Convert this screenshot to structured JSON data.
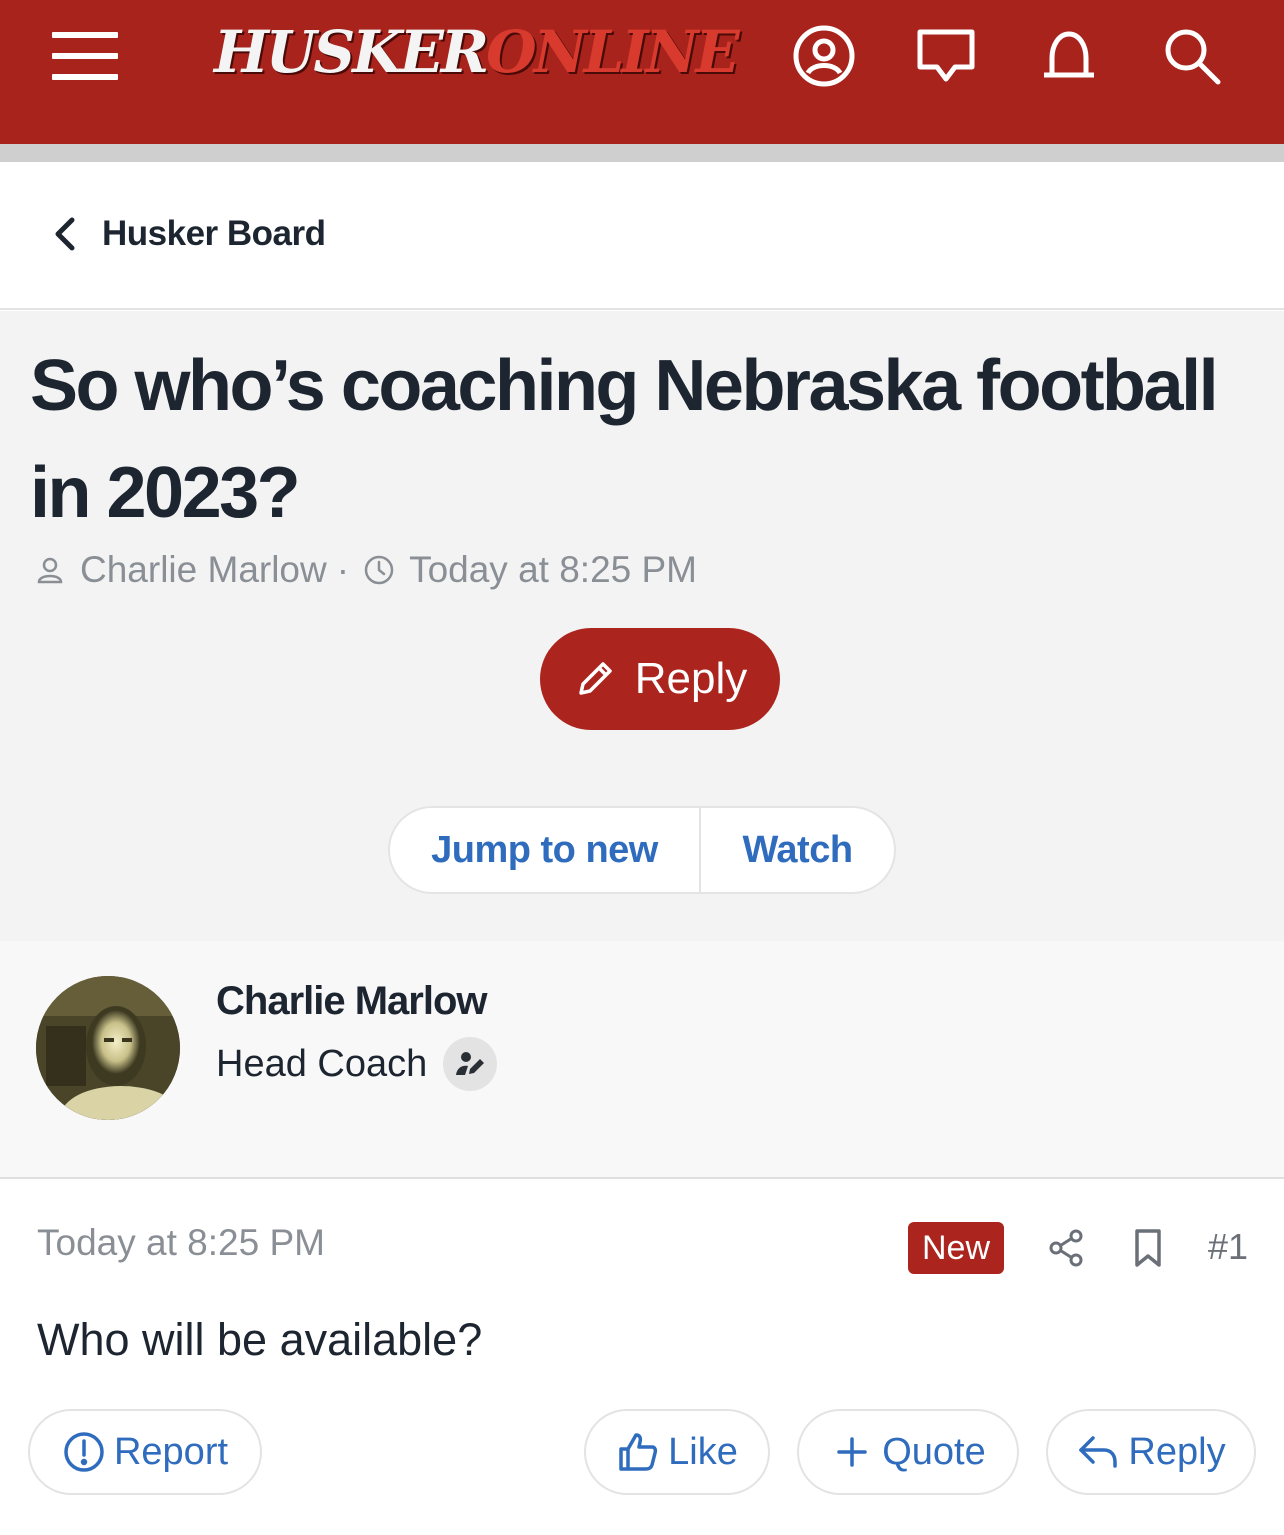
{
  "header": {
    "logo_part1": "HUSKER",
    "logo_part2": "ONLINE",
    "colors": {
      "brand_red": "#a8231c",
      "link_blue": "#2f6cbe"
    },
    "icons": [
      "menu-icon",
      "account-icon",
      "chat-icon",
      "bell-icon",
      "search-icon"
    ]
  },
  "breadcrumb": {
    "label": "Husker Board"
  },
  "thread": {
    "title": "So who’s coaching Nebraska football in 2023?",
    "author": "Charlie Marlow",
    "separator": "·",
    "timestamp": "Today at 8:25 PM",
    "reply_label": "Reply",
    "jump_label": "Jump to new",
    "watch_label": "Watch"
  },
  "post_author": {
    "name": "Charlie Marlow",
    "role": "Head Coach"
  },
  "post": {
    "timestamp": "Today at 8:25 PM",
    "badge": "New",
    "number": "#1",
    "body": "Who will be available?",
    "actions": {
      "report": "Report",
      "like": "Like",
      "quote": "Quote",
      "reply": "Reply"
    }
  }
}
